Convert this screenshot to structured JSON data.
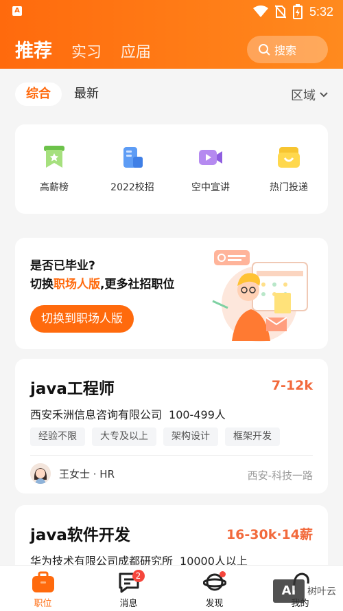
{
  "status_bar": {
    "time": "5:32",
    "app_icon_text": "A"
  },
  "header": {
    "tabs": [
      {
        "label": "推荐",
        "active": true
      },
      {
        "label": "实习",
        "active": false
      },
      {
        "label": "应届",
        "active": false
      }
    ],
    "search_label": "搜索"
  },
  "filter": {
    "options": [
      {
        "label": "综合",
        "active": true
      },
      {
        "label": "最新",
        "active": false
      }
    ],
    "region_label": "区域"
  },
  "entries": [
    {
      "label": "高薪榜",
      "icon": "ribbon-icon"
    },
    {
      "label": "2022校招",
      "icon": "building-icon"
    },
    {
      "label": "空中宣讲",
      "icon": "video-camera-icon"
    },
    {
      "label": "热门投递",
      "icon": "mailbox-icon"
    }
  ],
  "banner": {
    "line1": "是否已毕业?",
    "line2_prefix": "切换",
    "line2_highlight": "职场人版",
    "line2_suffix": ",更多社招职位",
    "button_label": "切换到职场人版"
  },
  "jobs": [
    {
      "title": "java工程师",
      "salary": "7-12k",
      "company": "西安禾洲信息咨询有限公司",
      "size": "100-499人",
      "tags": [
        "经验不限",
        "大专及以上",
        "架构设计",
        "框架开发"
      ],
      "recruiter": "王女士 · HR",
      "location": "西安-科技一路"
    },
    {
      "title": "java软件开发",
      "salary": "16-30k·14薪",
      "company": "华为技术有限公司成都研究所",
      "size": "10000人以上"
    }
  ],
  "bottom_nav": [
    {
      "label": "职位",
      "active": true,
      "icon": "briefcase-icon"
    },
    {
      "label": "消息",
      "active": false,
      "icon": "chat-icon",
      "badge": "2"
    },
    {
      "label": "发现",
      "active": false,
      "icon": "planet-icon"
    },
    {
      "label": "我的",
      "active": false,
      "icon": "profile-icon"
    }
  ],
  "watermark": {
    "box_text": "AI",
    "text": "树叶云"
  },
  "colors": {
    "accent": "#ff6a0d",
    "salary": "#f26a3c",
    "badge": "#f5463c"
  }
}
